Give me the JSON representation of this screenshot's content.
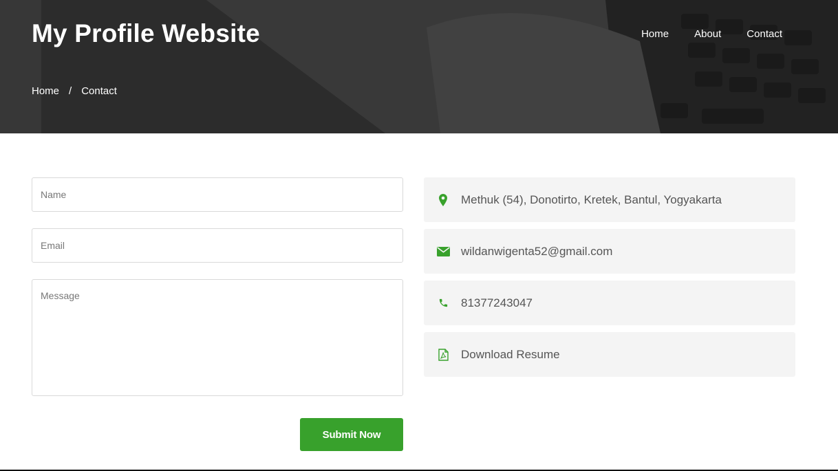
{
  "brand": {
    "title": "My Profile Website"
  },
  "nav": {
    "items": [
      "Home",
      "About",
      "Contact"
    ]
  },
  "breadcrumb": {
    "home": "Home",
    "separator": "/",
    "current": "Contact"
  },
  "form": {
    "name_placeholder": "Name",
    "email_placeholder": "Email",
    "message_placeholder": "Message",
    "submit_label": "Submit Now"
  },
  "info": [
    {
      "icon": "map-marker-icon",
      "text": "Methuk (54), Donotirto, Kretek, Bantul, Yogyakarta"
    },
    {
      "icon": "envelope-icon",
      "text": "wildanwigenta52@gmail.com"
    },
    {
      "icon": "phone-icon",
      "text": "81377243047"
    },
    {
      "icon": "pdf-file-icon",
      "text": "Download Resume"
    }
  ],
  "colors": {
    "accent": "#38a12c",
    "card_bg": "#f4f4f4",
    "hero_overlay": "#2f2f2f"
  }
}
